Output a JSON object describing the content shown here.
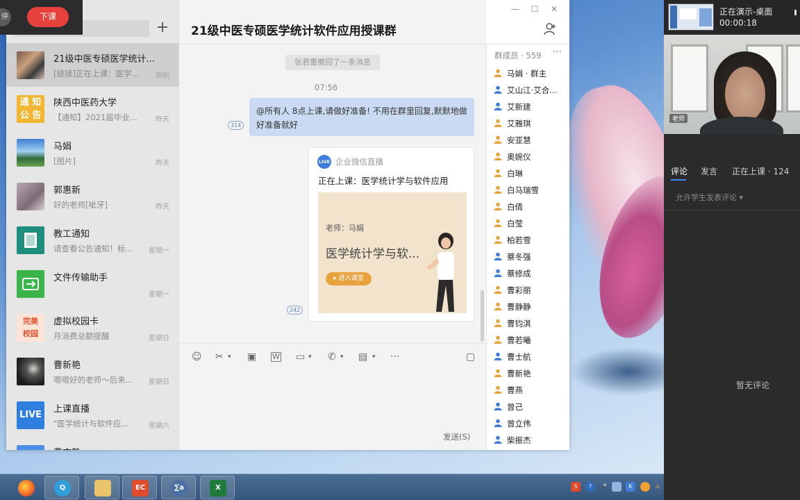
{
  "float_bar": {
    "left_label": "停",
    "end_class_label": "下课"
  },
  "window": {
    "controls": {
      "minimize": "—",
      "maximize": "☐",
      "close": "✕"
    }
  },
  "conversations": [
    {
      "name": "21级中医专硕医学统计...",
      "preview": "[链接]正在上课：医学...",
      "time": "刚刚",
      "avatar": "group",
      "active": true
    },
    {
      "name": "陕西中医药大学",
      "preview": "【通知】2021届毕业...",
      "time": "昨天",
      "avatar": "notice"
    },
    {
      "name": "马娟",
      "preview": "[图片]",
      "time": "昨天",
      "avatar": "landscape"
    },
    {
      "name": "郭惠新",
      "preview": "好的老师[呲牙]",
      "time": "昨天",
      "avatar": "photo"
    },
    {
      "name": "教工通知",
      "preview": "请查看公告通知！标...",
      "time": "星期一",
      "avatar": "book"
    },
    {
      "name": "文件传输助手",
      "preview": "",
      "time": "星期一",
      "avatar": "folder"
    },
    {
      "name": "虚拟校园卡",
      "preview": "月消费总额提醒",
      "time": "星期日",
      "avatar": "card"
    },
    {
      "name": "曹新艳",
      "preview": "嗯嗯好的老师～后来...",
      "time": "星期日",
      "avatar": "dark"
    },
    {
      "name": "上课直播",
      "preview": "\"医学统计与软件应...",
      "time": "星期六",
      "avatar": "live"
    },
    {
      "name": "曹文静",
      "preview": "",
      "time": "",
      "avatar": "blue"
    }
  ],
  "avatar_text": {
    "notice": "通 知\n公 告",
    "card": "完美\n校园",
    "live": "LIVE"
  },
  "chat": {
    "title": "21级中医专硕医学统计软件应用授课群",
    "recall_notice": "张君蕾撤回了一条消息",
    "time": "07:56",
    "message": "@所有人  8点上课,请做好准备! 不用在群里回复,默默地做好准备就好",
    "read_count_1": "314",
    "read_count_2": "242",
    "card": {
      "source_badge": "LIVE",
      "source": "企业微信直播",
      "title": "正在上课：医学统计学与软件应用",
      "teacher": "老师：马娟",
      "course": "医学统计学与软...",
      "enter_button": "▸ 进入课堂"
    },
    "toolbar": {
      "emoji": "☺",
      "screenshot": "✂",
      "image": "▣",
      "doc": "W",
      "file": "▭",
      "call": "✆",
      "live": "▤",
      "more": "···",
      "history": "▢",
      "dropdown": "▾"
    },
    "send_button": "发送(S)"
  },
  "members": {
    "title": "群成员 · 559",
    "more": "···",
    "list": [
      {
        "name": "马娟 · 群主",
        "gender": "f"
      },
      {
        "name": "艾山江·艾合...",
        "gender": "m"
      },
      {
        "name": "艾新建",
        "gender": "m"
      },
      {
        "name": "艾雅琪",
        "gender": "f"
      },
      {
        "name": "安亚慧",
        "gender": "f"
      },
      {
        "name": "奥婉仪",
        "gender": "f"
      },
      {
        "name": "白琳",
        "gender": "f"
      },
      {
        "name": "白马瑞雪",
        "gender": "f"
      },
      {
        "name": "白倩",
        "gender": "f"
      },
      {
        "name": "白莹",
        "gender": "f"
      },
      {
        "name": "柏若雪",
        "gender": "f"
      },
      {
        "name": "蔡冬强",
        "gender": "m"
      },
      {
        "name": "蔡修成",
        "gender": "m"
      },
      {
        "name": "曹彩丽",
        "gender": "f"
      },
      {
        "name": "曹静静",
        "gender": "f"
      },
      {
        "name": "曹钧淇",
        "gender": "f"
      },
      {
        "name": "曹若曦",
        "gender": "f"
      },
      {
        "name": "曹士航",
        "gender": "m"
      },
      {
        "name": "曹新艳",
        "gender": "f"
      },
      {
        "name": "曹燕",
        "gender": "f"
      },
      {
        "name": "曾己",
        "gender": "m"
      },
      {
        "name": "曾立伟",
        "gender": "m"
      },
      {
        "name": "柴振杰",
        "gender": "m"
      }
    ]
  },
  "right_panel": {
    "status": "正在演示-桌面",
    "timer": "00:00:18",
    "video_tag": "老师",
    "tabs": {
      "comment": "评论",
      "speak": "发言",
      "in_class": "正在上课 · 124"
    },
    "allow_comments": "允许学生发表评论 ▾",
    "empty": "暂无评论"
  },
  "taskbar": {
    "apps": [
      {
        "name": "firefox",
        "label": ""
      },
      {
        "name": "search",
        "label": "Q"
      },
      {
        "name": "explorer",
        "label": ""
      },
      {
        "name": "ec",
        "label": "EC"
      },
      {
        "name": "math",
        "label": "∑a"
      },
      {
        "name": "excel",
        "label": "X"
      }
    ],
    "tray": [
      "S",
      "?",
      "🎤",
      "",
      "K",
      "",
      "⚠"
    ]
  },
  "colors": {
    "accent_blue": "#3e86f5",
    "end_class_red": "#e6423b",
    "male_icon": "#3f7ddc",
    "female_icon": "#e8a23e",
    "bubble": "#c9daf2"
  }
}
